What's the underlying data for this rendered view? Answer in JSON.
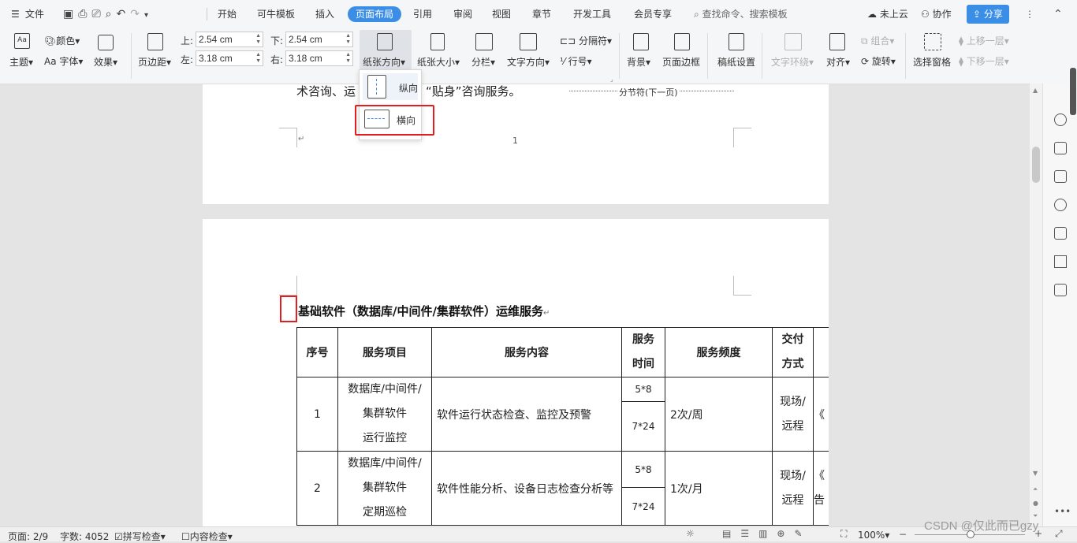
{
  "menubar": {
    "file_label": "文件",
    "tabs": [
      "开始",
      "可牛模板",
      "插入",
      "页面布局",
      "引用",
      "审阅",
      "视图",
      "章节",
      "开发工具",
      "会员专享"
    ],
    "active_tab": "页面布局",
    "search_placeholder": "查找命令、搜索模板",
    "cloud_status": "未上云",
    "collab_label": "协作",
    "share_label": "分享"
  },
  "ribbon": {
    "theme_label": "主题",
    "color_label": "颜色",
    "font_label": "字体",
    "effect_label": "效果",
    "margin_label": "页边距",
    "margin_top_label": "上:",
    "margin_top_value": "2.54 cm",
    "margin_bottom_label": "下:",
    "margin_bottom_value": "2.54 cm",
    "margin_left_label": "左:",
    "margin_left_value": "3.18 cm",
    "margin_right_label": "右:",
    "margin_right_value": "3.18 cm",
    "orientation_label": "纸张方向",
    "paper_size_label": "纸张大小",
    "columns_label": "分栏",
    "text_direction_label": "文字方向",
    "separator_label": "分隔符",
    "line_number_label": "行号",
    "background_label": "背景",
    "page_border_label": "页面边框",
    "manuscript_label": "稿纸设置",
    "text_wrap_label": "文字环绕",
    "align_label": "对齐",
    "group_label": "组合",
    "rotate_label": "旋转",
    "selection_pane_label": "选择窗格",
    "bring_forward_label": "上移一层",
    "send_backward_label": "下移一层"
  },
  "orientation_menu": {
    "portrait_label": "纵向",
    "landscape_label": "横向"
  },
  "document": {
    "page1_line": "术咨询、运",
    "page1_line_rest": "方位，“贴身”咨询服务。",
    "section_break": "分节符(下一页)",
    "page_number": "1",
    "heading": "基础软件（数据库/中间件/集群软件）运维服务",
    "table": {
      "headers": [
        "序号",
        "服务项目",
        "服务内容",
        "服务时间",
        "服务频度",
        "交付方式"
      ],
      "header_time_lines": [
        "服务",
        "时间"
      ],
      "header_delivery_lines": [
        "交付",
        "方式"
      ],
      "rows": [
        {
          "no": "1",
          "item_lines": [
            "数据库/中间件/",
            "集群软件",
            "运行监控"
          ],
          "content": "软件运行状态检查、监控及预警",
          "times": [
            "5*8",
            "7*24"
          ],
          "frequency": "2次/周",
          "delivery_lines": [
            "现场/",
            "远程"
          ],
          "extra": "《"
        },
        {
          "no": "2",
          "item_lines": [
            "数据库/中间件/",
            "集群软件",
            "定期巡检"
          ],
          "content": "软件性能分析、设备日志检查分析等",
          "times": [
            "5*8",
            "7*24"
          ],
          "frequency": "1次/月",
          "delivery_lines": [
            "现场/",
            "远程"
          ],
          "extra": "《",
          "extra2": "告"
        }
      ]
    }
  },
  "statusbar": {
    "page": "页面: 2/9",
    "word_count": "字数: 4052",
    "spell_check": "拼写检查",
    "content_check": "内容检查",
    "zoom": "100%"
  },
  "watermark": "CSDN @仅此而已gzy",
  "colors": {
    "accent": "#3a8ee6",
    "highlight_box": "#e02020"
  }
}
